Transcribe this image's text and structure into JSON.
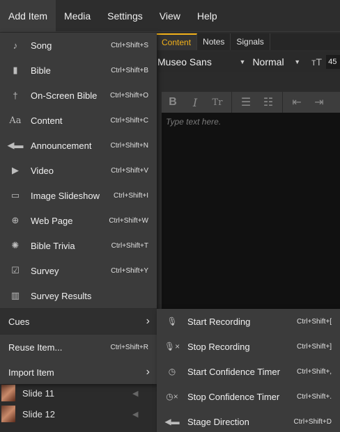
{
  "menubar": {
    "items": [
      {
        "label": "Add Item",
        "active": true
      },
      {
        "label": "Media"
      },
      {
        "label": "Settings"
      },
      {
        "label": "View"
      },
      {
        "label": "Help"
      }
    ]
  },
  "editor": {
    "tabs": [
      "Content",
      "Notes",
      "Signals"
    ],
    "font_name": "Museo Sans",
    "font_weight": "Normal",
    "font_size": "45",
    "placeholder": "Type text here."
  },
  "add_item_menu": {
    "items": [
      {
        "label": "Song",
        "shortcut": "Ctrl+Shift+S",
        "icon": "music-note-icon"
      },
      {
        "label": "Bible",
        "shortcut": "Ctrl+Shift+B",
        "icon": "bible-icon"
      },
      {
        "label": "On-Screen Bible",
        "shortcut": "Ctrl+Shift+O",
        "icon": "cross-icon"
      },
      {
        "label": "Content",
        "shortcut": "Ctrl+Shift+C",
        "icon": "text-aa-icon"
      },
      {
        "label": "Announcement",
        "shortcut": "Ctrl+Shift+N",
        "icon": "megaphone-icon"
      },
      {
        "label": "Video",
        "shortcut": "Ctrl+Shift+V",
        "icon": "play-circle-icon"
      },
      {
        "label": "Image Slideshow",
        "shortcut": "Ctrl+Shift+I",
        "icon": "image-stack-icon"
      },
      {
        "label": "Web Page",
        "shortcut": "Ctrl+Shift+W",
        "icon": "globe-icon"
      },
      {
        "label": "Bible Trivia",
        "shortcut": "Ctrl+Shift+T",
        "icon": "trivia-wheel-icon"
      },
      {
        "label": "Survey",
        "shortcut": "Ctrl+Shift+Y",
        "icon": "checkbox-icon"
      },
      {
        "label": "Survey Results",
        "shortcut": "",
        "icon": "bar-chart-icon"
      }
    ],
    "cues_label": "Cues",
    "reuse_label": "Reuse Item...",
    "reuse_shortcut": "Ctrl+Shift+R",
    "import_label": "Import Item"
  },
  "cues_submenu": {
    "items": [
      {
        "label": "Start Recording",
        "shortcut": "Ctrl+Shift+[",
        "icon": "microphone-icon"
      },
      {
        "label": "Stop Recording",
        "shortcut": "Ctrl+Shift+]",
        "icon": "microphone-stop-icon"
      },
      {
        "label": "Start Confidence Timer",
        "shortcut": "Ctrl+Shift+,",
        "icon": "clock-icon"
      },
      {
        "label": "Stop Confidence Timer",
        "shortcut": "Ctrl+Shift+.",
        "icon": "clock-stop-icon"
      },
      {
        "label": "Stage Direction",
        "shortcut": "Ctrl+Shift+D",
        "icon": "megaphone-icon"
      }
    ]
  },
  "slides": [
    {
      "label": "Slide 11"
    },
    {
      "label": "Slide 12"
    }
  ],
  "colors": {
    "accent": "#f3b21a",
    "menu_bg": "#3b3b3b",
    "bar_bg": "#2d2d2d"
  }
}
